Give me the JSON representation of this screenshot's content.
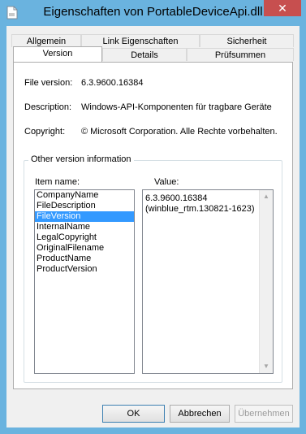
{
  "window": {
    "title": "Eigenschaften von PortableDeviceApi.dll",
    "close_glyph": "✕"
  },
  "tabs": {
    "row1": [
      "Allgemein",
      "Link Eigenschaften",
      "Sicherheit"
    ],
    "row2": [
      "Version",
      "Details",
      "Prüfsummen"
    ],
    "active": "Version"
  },
  "info": {
    "file_version_label": "File version:",
    "file_version_value": "6.3.9600.16384",
    "description_label": "Description:",
    "description_value": "Windows-API-Komponenten für tragbare Geräte",
    "copyright_label": "Copyright:",
    "copyright_value": "© Microsoft Corporation. Alle Rechte vorbehalten."
  },
  "other_info": {
    "group_title": "Other version information",
    "item_name_header": "Item name:",
    "value_header": "Value:",
    "items": [
      "CompanyName",
      "FileDescription",
      "FileVersion",
      "InternalName",
      "LegalCopyright",
      "OriginalFilename",
      "ProductName",
      "ProductVersion"
    ],
    "selected_item": "FileVersion",
    "value_text": "6.3.9600.16384\n(winblue_rtm.130821-1623)"
  },
  "buttons": {
    "ok": "OK",
    "cancel": "Abbrechen",
    "apply": "Übernehmen"
  }
}
